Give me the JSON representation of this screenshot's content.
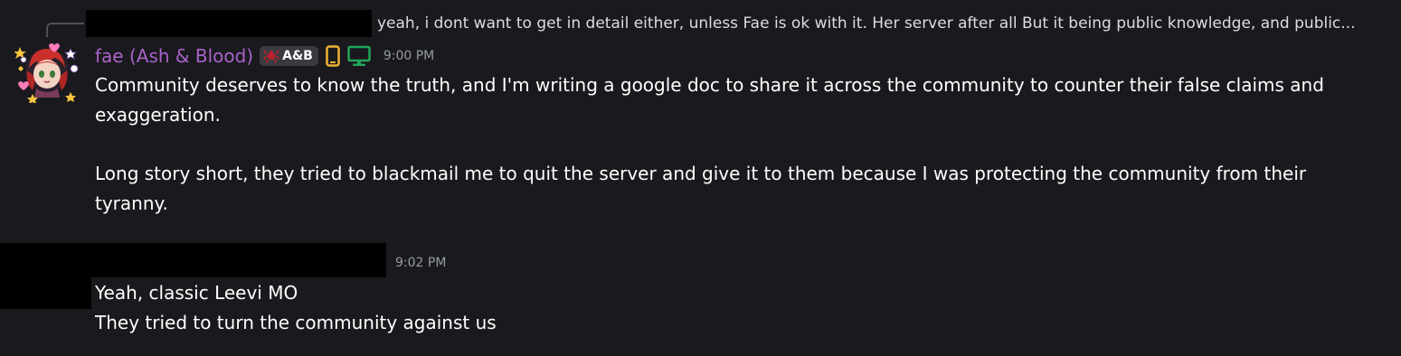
{
  "reply": {
    "preview_text": "yeah, i dont want to get in detail either, unless Fae is ok with it. Her server after all  But it being public knowledge, and public..."
  },
  "message1": {
    "author": "fae (Ash & Blood)",
    "author_color": "#a962c9",
    "tag_label": "A&B",
    "timestamp": "9:00 PM",
    "icons": [
      "mobile-icon",
      "desktop-icon"
    ],
    "paragraphs": [
      "Community deserves to know the truth, and I'm writing a google doc to share it across the community to counter their false claims and exaggeration.",
      "Long story short, they tried to blackmail me to quit the server and give it to them because I was protecting the community from their tyranny."
    ]
  },
  "message2": {
    "timestamp": "9:02 PM",
    "lines": [
      "Yeah, classic Leevi MO",
      "They tried to turn the community against us"
    ]
  },
  "colors": {
    "background": "#1a1a1e",
    "timestamp": "#949ba4",
    "mobile_icon": "#f0b232",
    "desktop_icon": "#23a55a"
  }
}
